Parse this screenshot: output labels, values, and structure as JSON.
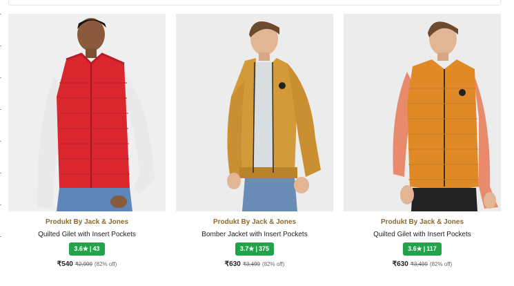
{
  "products": [
    {
      "brand": "Produkt By Jack & Jones",
      "title": "Quilted Gilet with Insert Pockets",
      "rating": "3.6★",
      "reviews": "43",
      "price": "₹540",
      "mrp": "₹2,999",
      "discount": "(82% off)",
      "image": {
        "garment_color": "#d9262f",
        "inner_color": "#e9e9e9",
        "type": "gilet"
      }
    },
    {
      "brand": "Produkt By Jack & Jones",
      "title": "Bomber Jacket with Insert Pockets",
      "rating": "3.7★",
      "reviews": "375",
      "price": "₹630",
      "mrp": "₹3,499",
      "discount": "(82% off)",
      "image": {
        "garment_color": "#d39a3a",
        "inner_color": "#d8dde2",
        "type": "bomber"
      }
    },
    {
      "brand": "Produkt By Jack & Jones",
      "title": "Quilted Gilet with Insert Pockets",
      "rating": "3.6★",
      "reviews": "117",
      "price": "₹630",
      "mrp": "₹3,499",
      "discount": "(82% off)",
      "image": {
        "garment_color": "#e08a27",
        "inner_color": "#e88a6c",
        "type": "gilet"
      }
    }
  ],
  "colors": {
    "brand_text": "#8b6a2b",
    "rating_bg": "#22a34a"
  }
}
